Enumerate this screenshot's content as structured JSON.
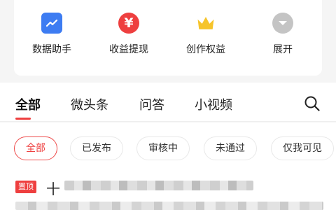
{
  "tools": [
    {
      "label": "数据助手",
      "icon": "trend-chart-icon",
      "color": "#3d7cf2"
    },
    {
      "label": "收益提现",
      "icon": "yen-icon",
      "color": "#ee3f3f"
    },
    {
      "label": "创作权益",
      "icon": "crown-icon",
      "color": "#f6c42b"
    },
    {
      "label": "展开",
      "icon": "chevron-down-icon",
      "color": "#c4c4c4"
    }
  ],
  "tabs": [
    {
      "label": "全部",
      "active": true
    },
    {
      "label": "微头条",
      "active": false
    },
    {
      "label": "问答",
      "active": false
    },
    {
      "label": "小视频",
      "active": false
    }
  ],
  "filters": [
    {
      "label": "全部",
      "active": true
    },
    {
      "label": "已发布",
      "active": false
    },
    {
      "label": "审核中",
      "active": false
    },
    {
      "label": "未通过",
      "active": false
    },
    {
      "label": "仅我可见",
      "active": false
    }
  ],
  "articles": [
    {
      "pin_label": "置顶",
      "title_visible": "十"
    }
  ],
  "colors": {
    "accent": "#ee3f3f",
    "primary_blue": "#3d7cf2",
    "crown": "#f6c42b",
    "muted": "#c4c4c4"
  }
}
